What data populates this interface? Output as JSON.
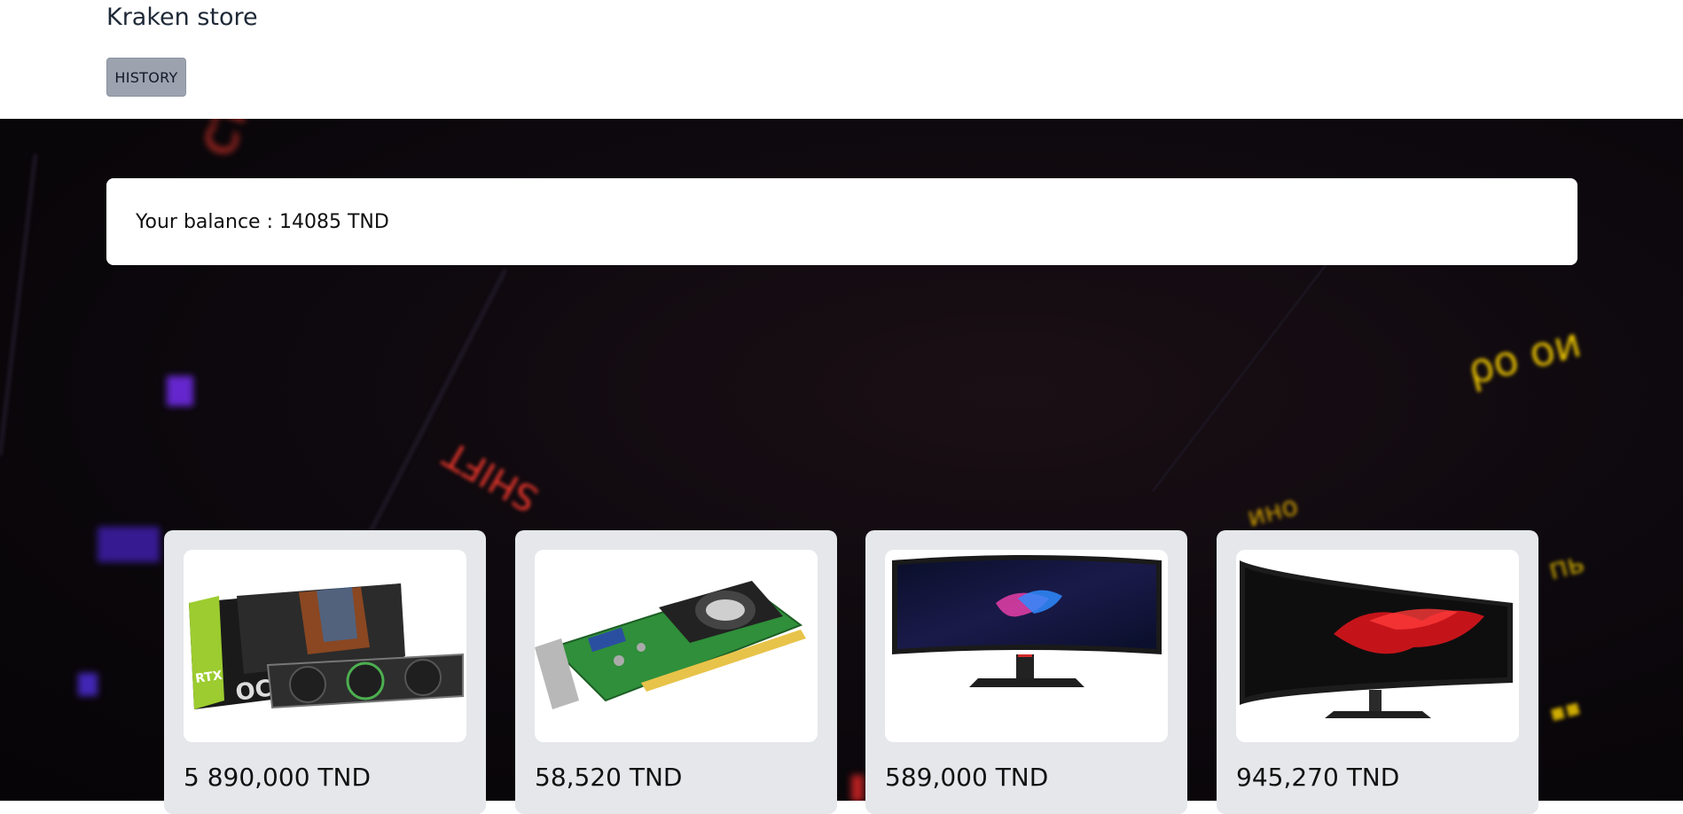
{
  "header": {
    "store_name": "Kraken store",
    "history_label": "HISTORY"
  },
  "balance": {
    "text": "Your balance : 14085 TND"
  },
  "products": [
    {
      "image": "graphics-card-palit-rtx-icon",
      "price": "5 890,000 TND"
    },
    {
      "image": "graphics-card-green-pcb-icon",
      "price": "58,520 TND"
    },
    {
      "image": "curved-monitor-dragon-icon",
      "price": "589,000 TND"
    },
    {
      "image": "curved-monitor-red-splash-icon",
      "price": "945,270 TND"
    }
  ],
  "colors": {
    "history_button_bg": "#9ca3af",
    "card_bg": "#e5e7eb",
    "hero_bg": "#0c080d"
  }
}
